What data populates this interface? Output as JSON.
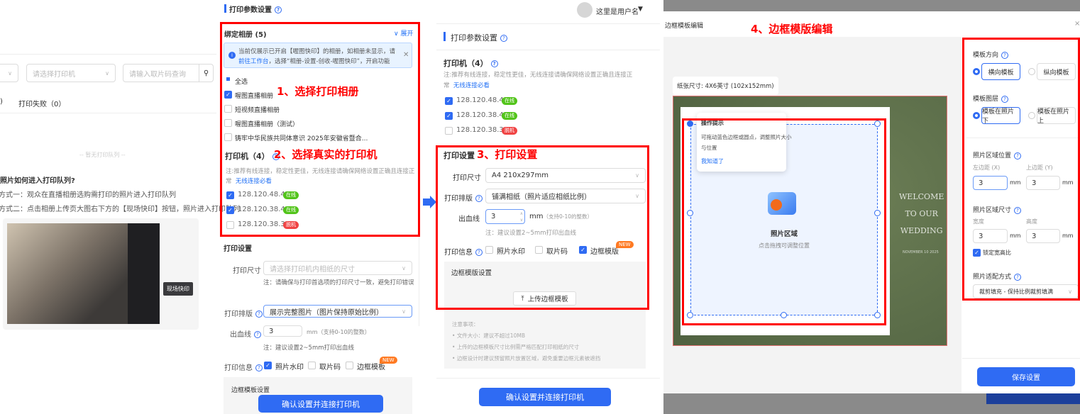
{
  "colors": {
    "accent": "#2f6bf3",
    "annotation": "#ff0000",
    "online": "#52c41a",
    "offline": "#f04444",
    "new_badge": "#ff7a22"
  },
  "queue_page": {
    "printer_select_placeholder": "请选择打印机",
    "code_search_placeholder": "请输入取片码查询",
    "tab_prev_tail": ")",
    "tab_failed": "打印失败（0）",
    "empty": "-- 暂无打印队列 --",
    "help_title": "照片如何进入打印队列?",
    "method1": "方式一：观众在直播相册选购需打印的照片进入打印队列",
    "method2": "方式二：点击相册上传页大图右下方的【现场快印】按钮，照片进入打印队列",
    "tooltip": "现场快印"
  },
  "panel1": {
    "title": "打印参数设置",
    "albums_title": "绑定相册 (5)",
    "expand": "展开",
    "alert_line1": "当前仅展示已开启【喔图快印】的相册，如相册未显示，请",
    "alert_link": "前往工作台",
    "alert_line2": "，选择“相册-设置-创收-喔图快印”，开启功能",
    "albums": [
      {
        "label": "全选",
        "state": "indeterminate"
      },
      {
        "label": "喔图直播相册",
        "state": "checked"
      },
      {
        "label": "短视频直播相册",
        "state": "unchecked"
      },
      {
        "label": "喔图直播相册（测试）",
        "state": "unchecked"
      },
      {
        "label": "铸牢中华民族共同体意识 2025年安徽省暨合...",
        "state": "unchecked"
      }
    ],
    "annotation1": "1、选择打印相册",
    "printers_title": "打印机（4）",
    "annotation2": "2、选择真实的打印机",
    "printer_note": "注:推荐有线连接，稳定性更佳，无线连接请确保网络设置正确且连接正常",
    "printer_link": "无线连接必看",
    "printers": [
      {
        "ip": "128.120.48.40",
        "status": "在线",
        "checked": true
      },
      {
        "ip": "128.120.38.40",
        "status": "在线",
        "checked": true
      },
      {
        "ip": "128.120.38.31",
        "status": "脱机",
        "checked": false
      }
    ],
    "print_settings": "打印设置",
    "size_label": "打印尺寸",
    "size_placeholder": "请选择打印机内相纸的尺寸",
    "size_note": "注：请确保与打印首选项的打印尺寸一致，避免打印错误",
    "layout_label": "打印排版",
    "layout_value": "展示完整图片（图片保持原始比例）",
    "bleed_label": "出血线",
    "bleed_value": "3",
    "bleed_unit": "mm（支持0-10的整数）",
    "bleed_note": "注：建议设置2~5mm打印出血线",
    "info_label": "打印信息",
    "info_opts": [
      {
        "label": "照片水印",
        "checked": true
      },
      {
        "label": "取片码",
        "checked": false
      },
      {
        "label": "边框模板",
        "checked": false
      }
    ],
    "new": "NEW",
    "frame_settings": "边框模板设置",
    "confirm": "确认设置并连接打印机"
  },
  "panel2": {
    "username": "这里是用户名",
    "title": "打印参数设置",
    "printers_title": "打印机（4）",
    "printer_note": "注:推荐有线连接，稳定性更佳，无线连接请确保网络设置正确且连接正常",
    "printer_link": "无线连接必看",
    "printers": [
      {
        "ip": "128.120.48.40",
        "status": "在线",
        "checked": true
      },
      {
        "ip": "128.120.38.40",
        "status": "在线",
        "checked": true
      },
      {
        "ip": "128.120.38.31",
        "status": "脱机",
        "checked": false
      }
    ],
    "print_settings": "打印设置",
    "annotation3": "3、打印设置",
    "size_label": "打印尺寸",
    "size_value": "A4 210x297mm",
    "layout_label": "打印排版",
    "layout_value": "铺满相纸（照片适应相纸比例）",
    "bleed_label": "出血线",
    "bleed_value": "3",
    "bleed_unit": "mm",
    "bleed_hint": "（支持0-10的整数）",
    "bleed_note": "注：建议设置2~5mm打印出血线",
    "info_label": "打印信息",
    "info_opts": [
      {
        "label": "照片水印",
        "checked": false
      },
      {
        "label": "取片码",
        "checked": false
      },
      {
        "label": "边框模版",
        "checked": true
      }
    ],
    "new": "NEW",
    "frame_settings": "边框模版设置",
    "upload": "上传边框模板",
    "notes_title": "注意事项：",
    "notes": [
      "文件大小：建议不超过10MB",
      "上传的边框模板尺寸比例需严格匹配打印相纸的尺寸",
      "边框设计时建议预留照片放置区域，避免重要边框元素被遮挡"
    ],
    "confirm": "确认设置并连接打印机"
  },
  "editor": {
    "title": "边框模板编辑",
    "annotation4": "4、边框模版编辑",
    "paper_size": "纸张尺寸: 4X6英寸 (102x152mm)",
    "tip_title": "操作提示",
    "tip_text1": "可拖动蓝色边框或圆点，调整照片大小",
    "tip_text2": "与位置",
    "tip_ok": "我知道了",
    "photo_area": "照片区域",
    "photo_area_hint": "点击拖拽可调整位置",
    "template_text": [
      "WELCOME",
      "TO OUR",
      "WEDDING"
    ],
    "template_date": "NOVEMBER 10 2025",
    "orientation_label": "模板方向",
    "orientation_opts": [
      {
        "label": "横向模板",
        "selected": true
      },
      {
        "label": "纵向模板",
        "selected": false
      }
    ],
    "layer_label": "模板图层",
    "layer_opts": [
      {
        "label": "模板在照片下",
        "selected": true
      },
      {
        "label": "模板在照片上",
        "selected": false
      }
    ],
    "position_label": "照片区域位置",
    "left_label": "左边距 (X)",
    "left_value": "3",
    "top_label": "上边距 (Y)",
    "top_value": "3",
    "size_label": "照片区域尺寸",
    "width_label": "宽度",
    "width_value": "3",
    "height_label": "高度",
    "height_value": "3",
    "unit": "mm",
    "lock_ratio": "锁定宽高比",
    "fit_label": "照片适配方式",
    "fit_value": "裁剪填充 - 保持比例裁剪填满",
    "save": "保存设置"
  }
}
